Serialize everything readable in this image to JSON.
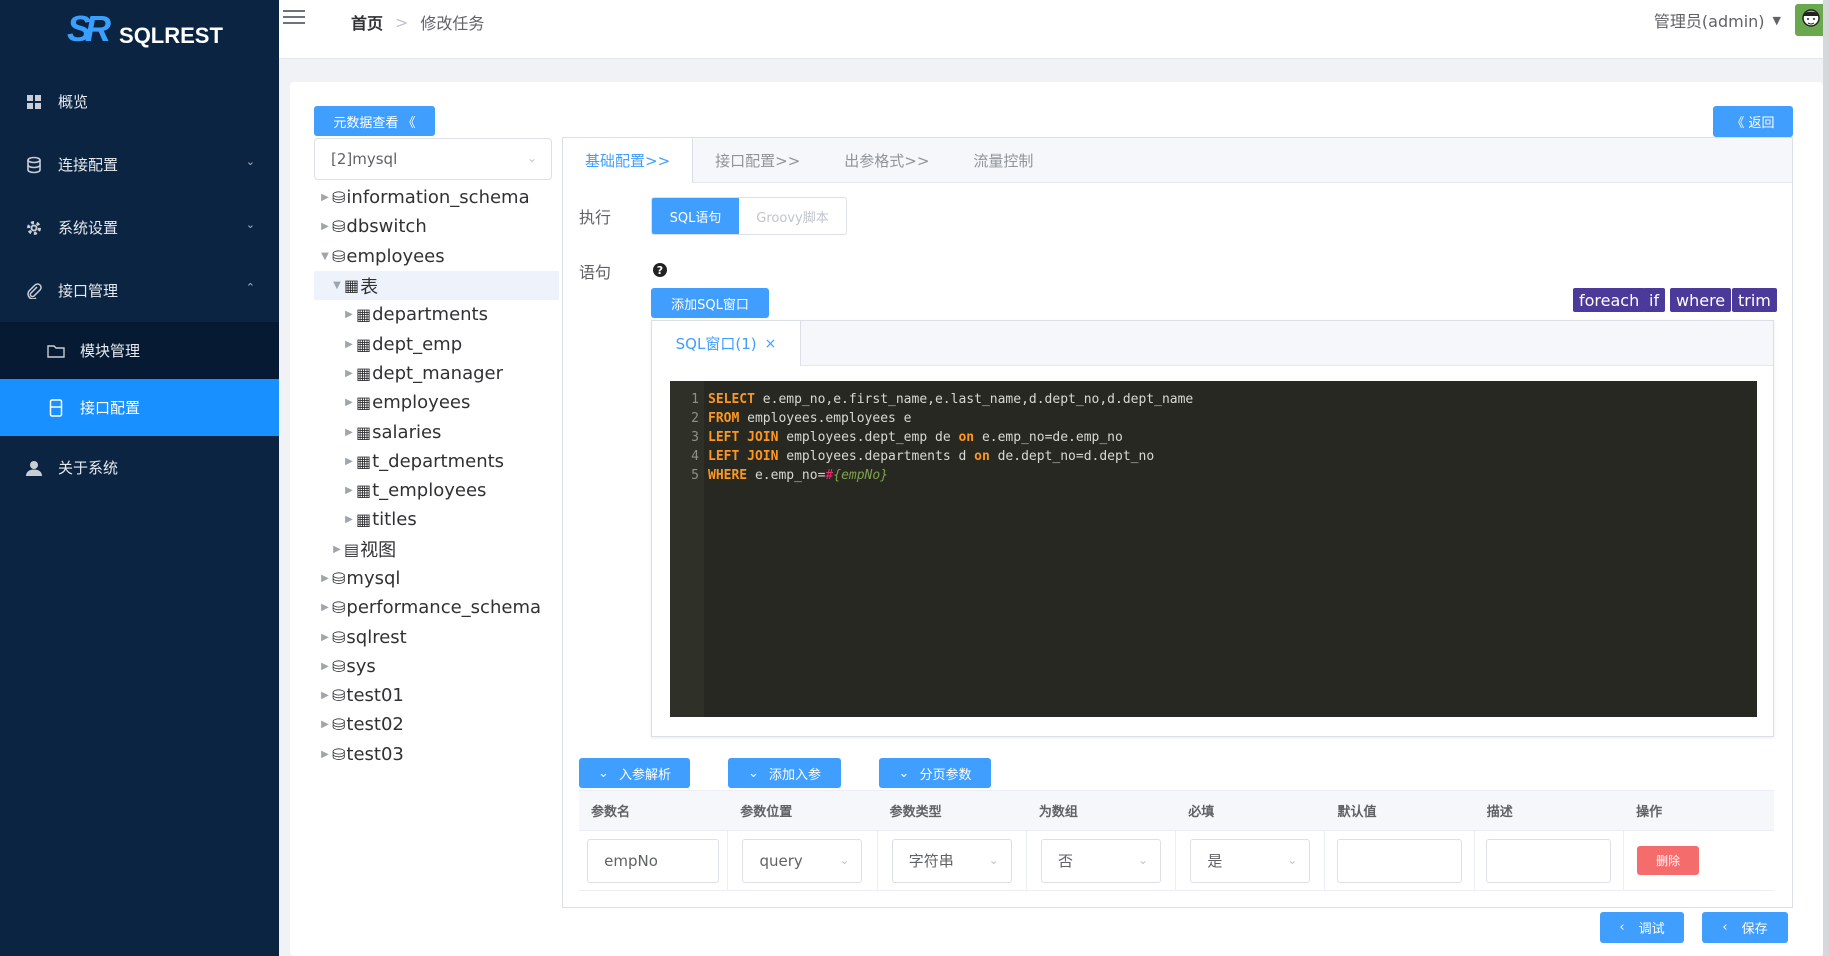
{
  "brand": {
    "logo_mark": "SR",
    "name": "SQLREST"
  },
  "sidebar": {
    "items": [
      {
        "label": "概览",
        "icon": "grid-icon"
      },
      {
        "label": "连接配置",
        "icon": "database-icon"
      },
      {
        "label": "系统设置",
        "icon": "gear-icon"
      },
      {
        "label": "接口管理",
        "icon": "paperclip-icon"
      },
      {
        "label": "模块管理",
        "icon": "folder-icon"
      },
      {
        "label": "接口配置",
        "icon": "file-icon"
      },
      {
        "label": "关于系统",
        "icon": "user-icon"
      }
    ]
  },
  "header": {
    "breadcrumb_home": "首页",
    "breadcrumb_separator": ">",
    "breadcrumb_current": "修改任务",
    "user": "管理员(admin)"
  },
  "toolbar": {
    "metadata_button": "元数据查看 《",
    "back_button": "《 返回"
  },
  "datasource": {
    "selected": "[2]mysql"
  },
  "tree": {
    "nodes": [
      {
        "label": "information_schema",
        "icon": "⛁",
        "level": 0
      },
      {
        "label": "dbswitch",
        "icon": "⛁",
        "level": 0
      },
      {
        "label": "employees",
        "icon": "⛁",
        "level": 0,
        "expanded": true
      },
      {
        "label": "表",
        "icon": "▦",
        "level": 1,
        "expanded": true
      },
      {
        "label": "departments",
        "icon": "▦",
        "level": 2
      },
      {
        "label": "dept_emp",
        "icon": "▦",
        "level": 2
      },
      {
        "label": "dept_manager",
        "icon": "▦",
        "level": 2
      },
      {
        "label": "employees",
        "icon": "▦",
        "level": 2
      },
      {
        "label": "salaries",
        "icon": "▦",
        "level": 2
      },
      {
        "label": "t_departments",
        "icon": "▦",
        "level": 2
      },
      {
        "label": "t_employees",
        "icon": "▦",
        "level": 2
      },
      {
        "label": "titles",
        "icon": "▦",
        "level": 2
      },
      {
        "label": "视图",
        "icon": "▤",
        "level": 1
      },
      {
        "label": "mysql",
        "icon": "⛁",
        "level": 0
      },
      {
        "label": "performance_schema",
        "icon": "⛁",
        "level": 0
      },
      {
        "label": "sqlrest",
        "icon": "⛁",
        "level": 0
      },
      {
        "label": "sys",
        "icon": "⛁",
        "level": 0
      },
      {
        "label": "test01",
        "icon": "⛁",
        "level": 0
      },
      {
        "label": "test02",
        "icon": "⛁",
        "level": 0
      },
      {
        "label": "test03",
        "icon": "⛁",
        "level": 0
      }
    ]
  },
  "tabs": [
    "基础配置>>",
    "接口配置>>",
    "出参格式>>",
    "流量控制"
  ],
  "form": {
    "exec_label": "执行",
    "exec_options": [
      "SQL语句",
      "Groovy脚本"
    ],
    "statement_label": "语句",
    "help_icon": "question-circle-icon",
    "add_sql_window": "添加SQL窗口",
    "snippets": [
      "foreach",
      "if",
      "where",
      "trim"
    ],
    "sql_tab": "SQL窗口(1)",
    "sql_tab_close": "×"
  },
  "code": {
    "lines": [
      {
        "n": "1",
        "parts": [
          [
            "kw2",
            "SELECT"
          ],
          [
            "txt",
            " e.emp_no,e.first_name,e.last_name,d.dept_no,d.dept_name"
          ]
        ]
      },
      {
        "n": "2",
        "parts": [
          [
            "kw2",
            "FROM"
          ],
          [
            "txt",
            " employees.employees e"
          ]
        ]
      },
      {
        "n": "3",
        "parts": [
          [
            "kw2",
            "LEFT JOIN"
          ],
          [
            "txt",
            " employees.dept_emp de "
          ],
          [
            "kw2",
            "on"
          ],
          [
            "txt",
            " e.emp_no=de.emp_no"
          ]
        ]
      },
      {
        "n": "4",
        "parts": [
          [
            "kw2",
            "LEFT JOIN"
          ],
          [
            "txt",
            " employees.departments d "
          ],
          [
            "kw2",
            "on"
          ],
          [
            "txt",
            " de.dept_no=d.dept_no"
          ]
        ]
      },
      {
        "n": "5",
        "parts": [
          [
            "kw2",
            "WHERE"
          ],
          [
            "txt",
            " e.emp_no="
          ],
          [
            "ops",
            "#"
          ],
          [
            "par",
            "{empNo}"
          ]
        ]
      }
    ]
  },
  "param_buttons": [
    "入参解析",
    "添加入参",
    "分页参数"
  ],
  "params": {
    "headers": [
      "参数名",
      "参数位置",
      "参数类型",
      "为数组",
      "必填",
      "默认值",
      "描述",
      "操作"
    ],
    "row": {
      "name": "empNo",
      "position": "query",
      "type": "字符串",
      "is_array": "否",
      "required": "是",
      "default": "",
      "desc": "",
      "delete": "删除"
    }
  },
  "footer": {
    "debug": "调试",
    "save": "保存"
  },
  "colors": {
    "sidebar_bg": "#0a2442",
    "primary": "#409eff",
    "active_menu": "#1890ff",
    "danger": "#f56c6c",
    "snippet_bg": "#4b3a99",
    "editor_bg": "#272822"
  }
}
